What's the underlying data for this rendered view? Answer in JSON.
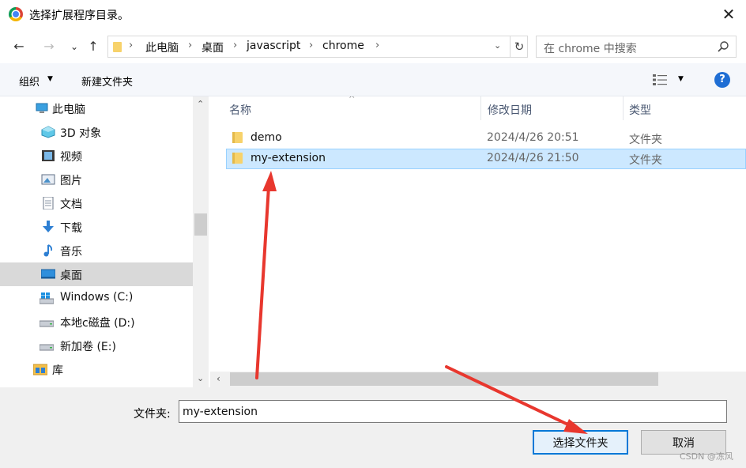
{
  "window": {
    "title": "选择扩展程序目录。",
    "close_glyph": "✕"
  },
  "nav": {
    "back_glyph": "←",
    "forward_glyph": "→",
    "recent_glyph": "⌄",
    "up_glyph": "↑",
    "breadcrumbs": [
      "此电脑",
      "桌面",
      "javascript",
      "chrome"
    ],
    "separator": "›",
    "dropdown_glyph": "⌄",
    "refresh_glyph": "↻",
    "search_placeholder": "在 chrome 中搜索"
  },
  "toolbar": {
    "organize_label": "组织",
    "new_folder_label": "新建文件夹",
    "help_label": "?"
  },
  "sidebar": {
    "items": [
      {
        "label": "此电脑",
        "icon": "computer-icon"
      },
      {
        "label": "3D 对象",
        "icon": "3d-objects-icon"
      },
      {
        "label": "视频",
        "icon": "video-icon"
      },
      {
        "label": "图片",
        "icon": "pictures-icon"
      },
      {
        "label": "文档",
        "icon": "documents-icon"
      },
      {
        "label": "下载",
        "icon": "downloads-icon"
      },
      {
        "label": "音乐",
        "icon": "music-icon"
      },
      {
        "label": "桌面",
        "icon": "desktop-icon",
        "selected": true
      },
      {
        "label": "Windows (C:)",
        "icon": "windows-drive-icon"
      },
      {
        "label": "本地c磁盘 (D:)",
        "icon": "drive-icon"
      },
      {
        "label": "新加卷 (E:)",
        "icon": "drive-icon"
      },
      {
        "label": "库",
        "icon": "library-icon"
      }
    ]
  },
  "list": {
    "columns": [
      "名称",
      "修改日期",
      "类型"
    ],
    "rows": [
      {
        "name": "demo",
        "date": "2024/4/26 20:51",
        "type": "文件夹",
        "selected": false
      },
      {
        "name": "my-extension",
        "date": "2024/4/26 21:50",
        "type": "文件夹",
        "selected": true
      }
    ]
  },
  "footer": {
    "folder_label": "文件夹:",
    "folder_value": "my-extension",
    "select_button": "选择文件夹",
    "cancel_button": "取消",
    "watermark": "CSDN @冻风"
  },
  "colors": {
    "accent": "#0078d7",
    "selection": "#cce8ff",
    "arrow": "#e8372e"
  }
}
